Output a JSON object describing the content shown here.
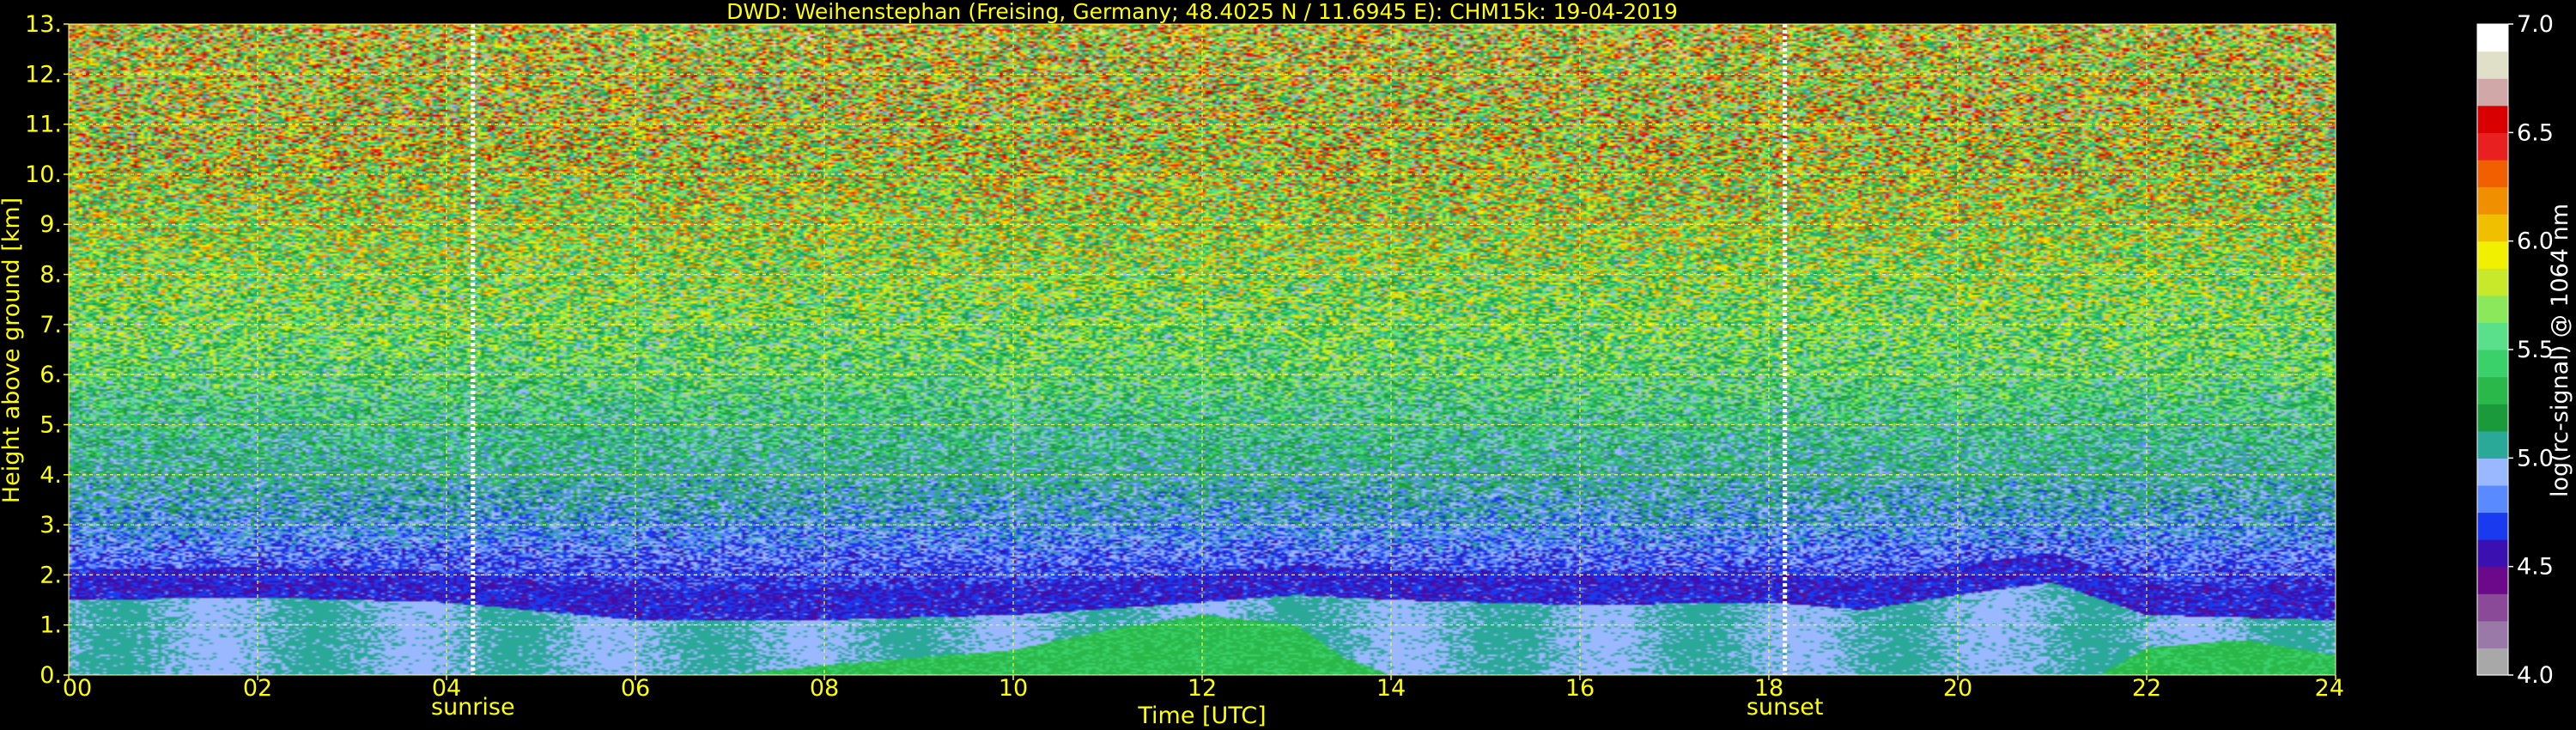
{
  "chart_data": {
    "type": "heatmap",
    "title": "DWD: Weihenstephan (Freising, Germany; 48.4025 N / 11.6945 E):    CHM15k: 19-04-2019",
    "xlabel": "Time [UTC]",
    "ylabel": "Height above ground [km]",
    "xlim": [
      0,
      24
    ],
    "ylim": [
      0,
      13
    ],
    "x_ticks": [
      0,
      2,
      4,
      6,
      8,
      10,
      12,
      14,
      16,
      18,
      20,
      22,
      24
    ],
    "x_tick_labels": [
      "00",
      "02",
      "04",
      "06",
      "08",
      "10",
      "12",
      "14",
      "16",
      "18",
      "20",
      "22",
      "24"
    ],
    "y_ticks": [
      0,
      1,
      2,
      3,
      4,
      5,
      6,
      7,
      8,
      9,
      10,
      11,
      12,
      13
    ],
    "y_tick_labels": [
      "0.",
      "1.",
      "2.",
      "3.",
      "4.",
      "5.",
      "6.",
      "7.",
      "8.",
      "9.",
      "10.",
      "11.",
      "12.",
      "13."
    ],
    "grid": true,
    "events": [
      {
        "label": "sunrise",
        "time": 4.28
      },
      {
        "label": "sunset",
        "time": 18.17
      }
    ],
    "colorbar": {
      "label": "log(rc-signal) @ 1064 nm",
      "range": [
        4.0,
        7.0
      ],
      "ticks": [
        4.0,
        4.5,
        5.0,
        5.5,
        6.0,
        6.5,
        7.0
      ],
      "tick_labels": [
        "4.0",
        "4.5",
        "5.0",
        "5.5",
        "6.0",
        "6.5",
        "7.0"
      ],
      "colors": [
        "#a8a8a8",
        "#9a78a8",
        "#8a4a98",
        "#6a0a8a",
        "#3a10b0",
        "#1a3af0",
        "#5a8aff",
        "#9ab8ff",
        "#2aa898",
        "#1a9a3a",
        "#2ab84a",
        "#3ad06a",
        "#5ae08a",
        "#8ae85a",
        "#c8e82a",
        "#f0f000",
        "#f0c000",
        "#f09000",
        "#f06000",
        "#e82020",
        "#d80000",
        "#d0a8a8",
        "#e0e0c8",
        "#ffffff"
      ]
    },
    "profile": {
      "heights_km": [
        0,
        0.4,
        1.0,
        1.5,
        2.5,
        4.0,
        6.0,
        9.0,
        13.0
      ],
      "log_signal": [
        5.0,
        5.0,
        4.9,
        4.6,
        4.8,
        5.1,
        5.4,
        5.7,
        5.95
      ]
    },
    "layer_top_km": {
      "times": [
        0,
        2,
        4,
        6,
        8,
        10,
        12,
        13,
        14,
        16,
        18,
        19,
        20,
        21,
        22,
        24
      ],
      "values": [
        1.5,
        1.55,
        1.45,
        1.1,
        1.1,
        1.2,
        1.45,
        1.6,
        1.5,
        1.4,
        1.45,
        1.3,
        1.6,
        1.85,
        1.2,
        1.1
      ]
    },
    "green_layer_top_km": {
      "times": [
        0,
        7,
        8,
        9,
        10,
        11,
        12,
        13,
        13.5,
        14,
        19,
        21.5,
        22,
        23,
        24
      ],
      "values": [
        0,
        0,
        0.2,
        0.35,
        0.5,
        0.9,
        1.2,
        1.0,
        0.35,
        0,
        0,
        0,
        0.55,
        0.7,
        0.4
      ]
    }
  }
}
